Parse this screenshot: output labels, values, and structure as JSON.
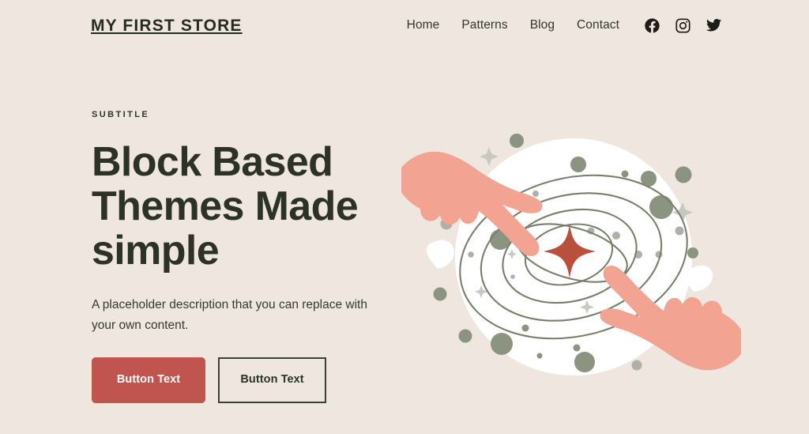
{
  "header": {
    "brand": "MY FIRST STORE",
    "nav": [
      {
        "label": "Home"
      },
      {
        "label": "Patterns"
      },
      {
        "label": "Blog"
      },
      {
        "label": "Contact"
      }
    ],
    "social": [
      {
        "name": "facebook-icon",
        "label": "Facebook"
      },
      {
        "name": "instagram-icon",
        "label": "Instagram"
      },
      {
        "name": "twitter-icon",
        "label": "Twitter"
      }
    ]
  },
  "hero": {
    "eyebrow": "SUBTITLE",
    "title": "Block Based Themes Made simple",
    "description": "A placeholder description that you can replace with your own content.",
    "primary_button": "Button Text",
    "secondary_button": "Button Text"
  },
  "illustration": {
    "alt": "Two hands pointing at a star inside orbiting rings",
    "center_icon": "four-point-star"
  },
  "colors": {
    "background": "#EFE7DF",
    "text_dark": "#2C3227",
    "accent_red": "#C05550",
    "star_red": "#B8503C",
    "hand_pink": "#F2A391",
    "ring_olive": "#78806C",
    "dot_sage": "#8A9480",
    "dot_grey": "#AFAFA9",
    "circle_white": "#FFFFFF"
  }
}
